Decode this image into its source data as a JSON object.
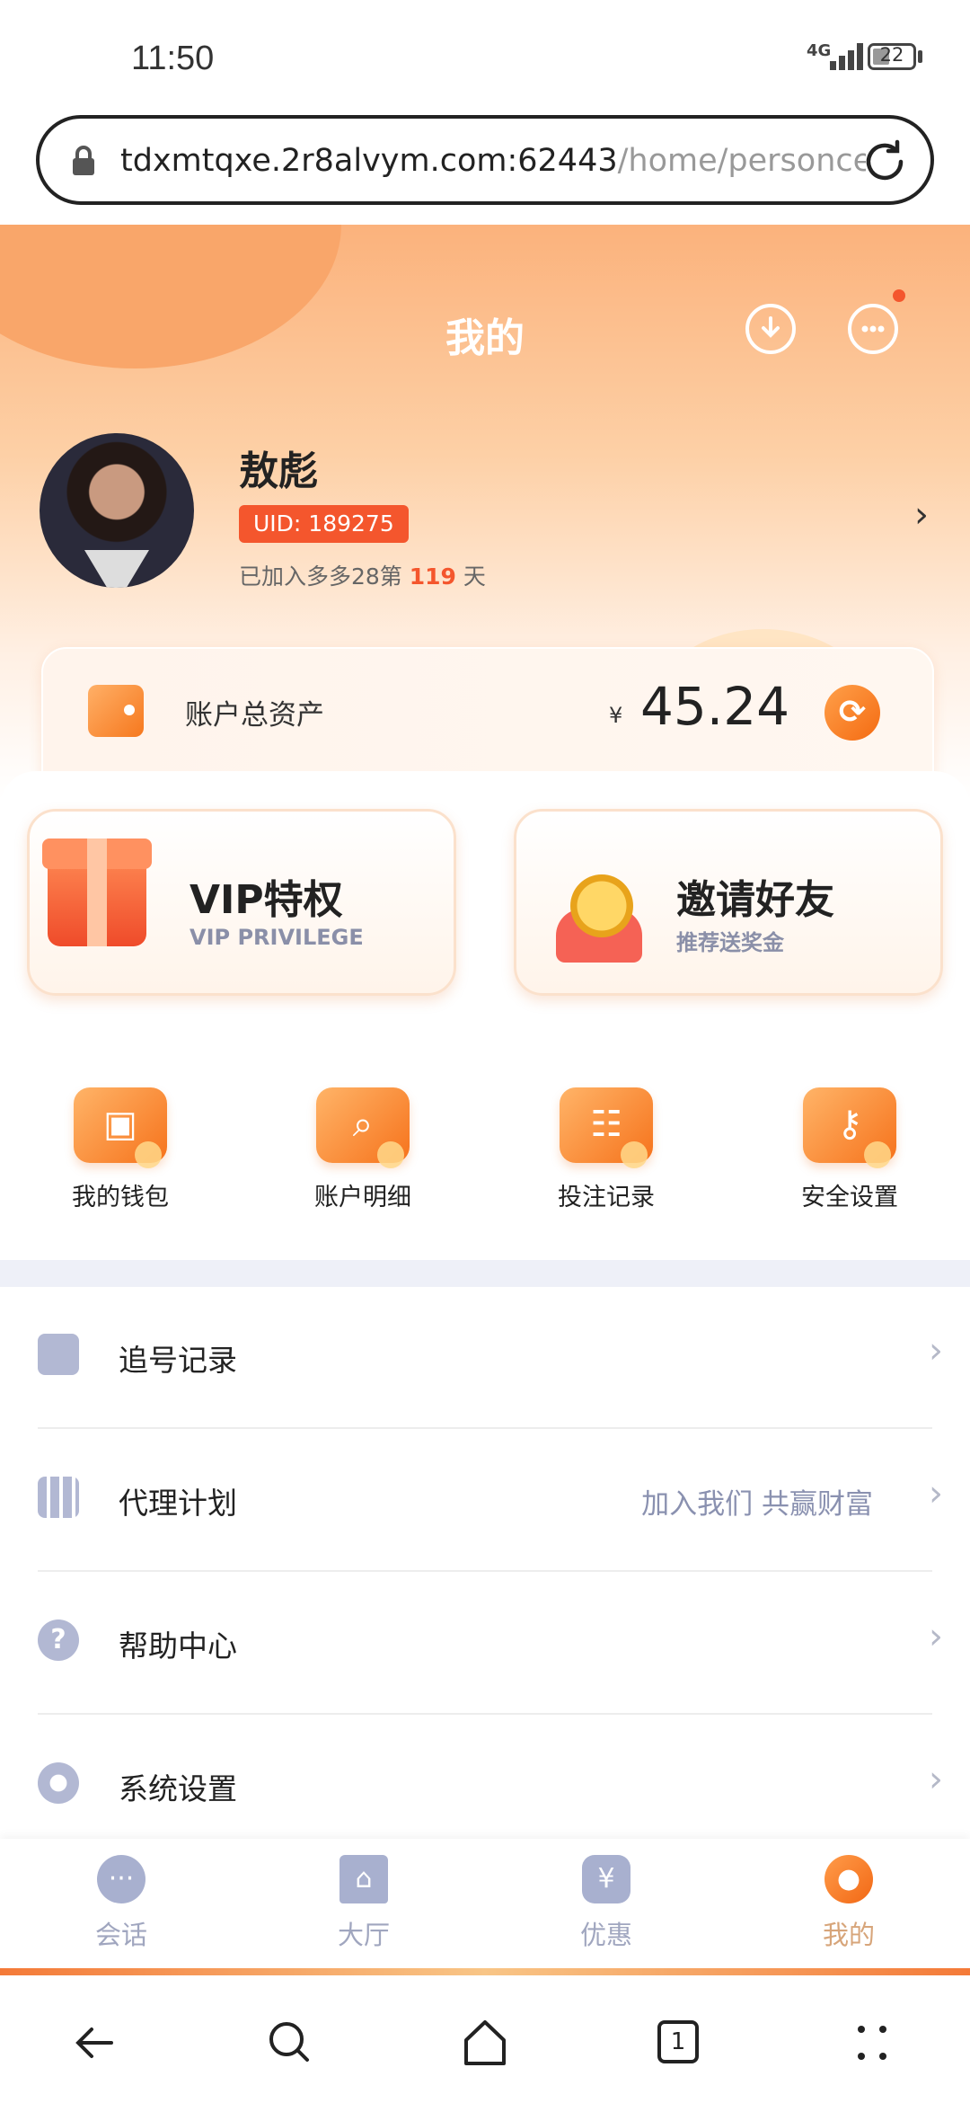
{
  "status": {
    "time": "11:50",
    "network": "4G",
    "battery": "22"
  },
  "browser": {
    "url_host": "tdxmtqxe.2r8alvym.com:62443",
    "url_path": "/home/personcente"
  },
  "header": {
    "title": "我的"
  },
  "profile": {
    "name": "敖彪",
    "uid": "UID: 189275",
    "joined_prefix": "已加入多多28第",
    "joined_days": "119",
    "joined_suffix": "天"
  },
  "assets": {
    "label": "账户总资产",
    "currency": "¥",
    "value": "45.24"
  },
  "promos": [
    {
      "title": "VIP特权",
      "subtitle": "VIP PRIVILEGE"
    },
    {
      "title": "邀请好友",
      "subtitle": "推荐送奖金"
    }
  ],
  "quick": [
    {
      "label": "我的钱包",
      "icon": "wallet-icon"
    },
    {
      "label": "账户明细",
      "icon": "search-icon"
    },
    {
      "label": "投注记录",
      "icon": "clipboard-icon"
    },
    {
      "label": "安全设置",
      "icon": "key-icon"
    }
  ],
  "menu": [
    {
      "label": "追号记录",
      "extra": "",
      "icon": "document-icon"
    },
    {
      "label": "代理计划",
      "extra": "加入我们 共赢财富",
      "icon": "qrcode-icon"
    },
    {
      "label": "帮助中心",
      "extra": "",
      "icon": "help-icon"
    },
    {
      "label": "系统设置",
      "extra": "",
      "icon": "gear-icon"
    }
  ],
  "tabs": [
    {
      "label": "会话",
      "icon": "chat-icon"
    },
    {
      "label": "大厅",
      "icon": "hall-icon"
    },
    {
      "label": "优惠",
      "icon": "coupon-icon"
    },
    {
      "label": "我的",
      "icon": "user-icon",
      "active": true
    }
  ],
  "nav": {
    "tab_count": "1"
  },
  "colors": {
    "accent": "#f26815",
    "uid_bg": "#f4562d"
  }
}
